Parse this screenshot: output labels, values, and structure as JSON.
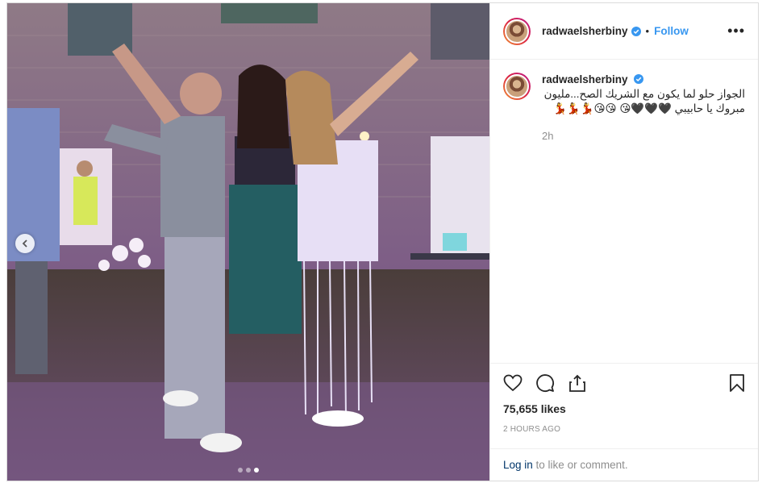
{
  "post": {
    "username": "radwaelsherbiny",
    "follow_sep": "•",
    "follow_label": "Follow",
    "more_label": "•••",
    "caption": "الجواز حلو لما يكون مع الشريك الصح...مليون مبروك يا حابيبي 🖤🖤🖤😘 😘😘💃💃💃",
    "caption_time": "2h",
    "likes": "75,655 likes",
    "posted_ago": "2 HOURS AGO",
    "login_link": "Log in",
    "login_suffix": " to like or comment."
  },
  "carousel": {
    "dots": 3,
    "active_index": 2
  },
  "icons": {
    "like": "heart-icon",
    "comment": "comment-icon",
    "share": "share-icon",
    "save": "bookmark-icon",
    "prev": "chevron-left-icon",
    "verified": "verified-badge-icon"
  },
  "colors": {
    "link": "#3897f0",
    "login_link": "#003569",
    "muted": "#8e8e8e",
    "verified": "#3897f0"
  }
}
